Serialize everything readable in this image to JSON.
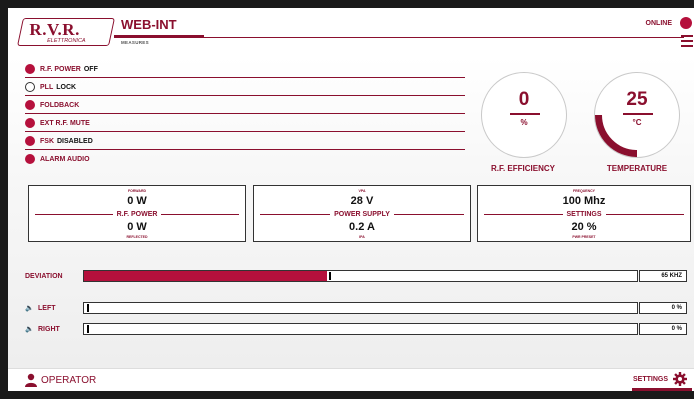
{
  "header": {
    "logo_text": "R.V.R.",
    "logo_sub": "ELETTRONICA",
    "title": "WEB-INT",
    "subtitle": "MEASURES",
    "online_label": "ONLINE",
    "menu_icon": "hamburger-icon"
  },
  "status": [
    {
      "label": "R.F. POWER",
      "value": "OFF",
      "active": true
    },
    {
      "label": "PLL",
      "value": "LOCK",
      "active": false
    },
    {
      "label": "FOLDBACK",
      "value": "",
      "active": true
    },
    {
      "label": "EXT R.F. MUTE",
      "value": "",
      "active": true
    },
    {
      "label": "FSK",
      "value": "DISABLED",
      "active": true
    },
    {
      "label": "ALARM AUDIO",
      "value": "",
      "active": true
    }
  ],
  "gauges": {
    "efficiency": {
      "value": "0",
      "unit": "%",
      "label": "R.F. EFFICIENCY",
      "level": 0
    },
    "temperature": {
      "value": "25",
      "unit": "°C",
      "label": "TEMPERATURE",
      "level": 0.25
    }
  },
  "boxes": {
    "rf_power": {
      "top_label": "FORWARD",
      "top_value": "0 W",
      "middle": "R.F. POWER",
      "bottom_value": "0 W",
      "bottom_label": "REFLECTED"
    },
    "power_supply": {
      "top_label": "VPA",
      "top_value": "28 V",
      "middle": "POWER SUPPLY",
      "bottom_value": "0.2 A",
      "bottom_label": "IPA"
    },
    "settings": {
      "top_label": "FREQUENCY",
      "top_value": "100 Mhz",
      "middle": "SETTINGS",
      "bottom_value": "20 %",
      "bottom_label": "PWR PRESET"
    }
  },
  "meters": {
    "deviation": {
      "label": "DEVIATION",
      "value": "65 KHZ",
      "level": 0.44
    },
    "left": {
      "label": "LEFT",
      "value": "0 %",
      "level": 0
    },
    "right": {
      "label": "RIGHT",
      "value": "0 %",
      "level": 0
    }
  },
  "footer": {
    "operator_label": "OPERATOR",
    "settings_label": "SETTINGS"
  },
  "colors": {
    "accent": "#8a0f2e",
    "indicator": "#b5103c"
  }
}
